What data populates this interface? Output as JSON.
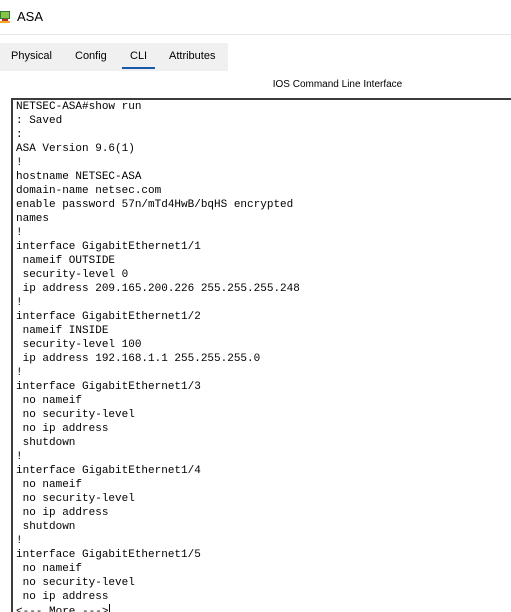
{
  "window": {
    "title": "ASA",
    "icon": "packet-tracer-icon"
  },
  "tabs": [
    {
      "label": "Physical",
      "active": false
    },
    {
      "label": "Config",
      "active": false
    },
    {
      "label": "CLI",
      "active": true
    },
    {
      "label": "Attributes",
      "active": false
    }
  ],
  "cli": {
    "heading": "IOS Command Line Interface",
    "lines": [
      "NETSEC-ASA#show run",
      ": Saved",
      ":",
      "ASA Version 9.6(1)",
      "!",
      "hostname NETSEC-ASA",
      "domain-name netsec.com",
      "enable password 57n/mTd4HwB/bqHS encrypted",
      "names",
      "!",
      "interface GigabitEthernet1/1",
      " nameif OUTSIDE",
      " security-level 0",
      " ip address 209.165.200.226 255.255.255.248",
      "!",
      "interface GigabitEthernet1/2",
      " nameif INSIDE",
      " security-level 100",
      " ip address 192.168.1.1 255.255.255.0",
      "!",
      "interface GigabitEthernet1/3",
      " no nameif",
      " no security-level",
      " no ip address",
      " shutdown",
      "!",
      "interface GigabitEthernet1/4",
      " no nameif",
      " no security-level",
      " no ip address",
      " shutdown",
      "!",
      "interface GigabitEthernet1/5",
      " no nameif",
      " no security-level",
      " no ip address",
      "<--- More --->"
    ]
  }
}
